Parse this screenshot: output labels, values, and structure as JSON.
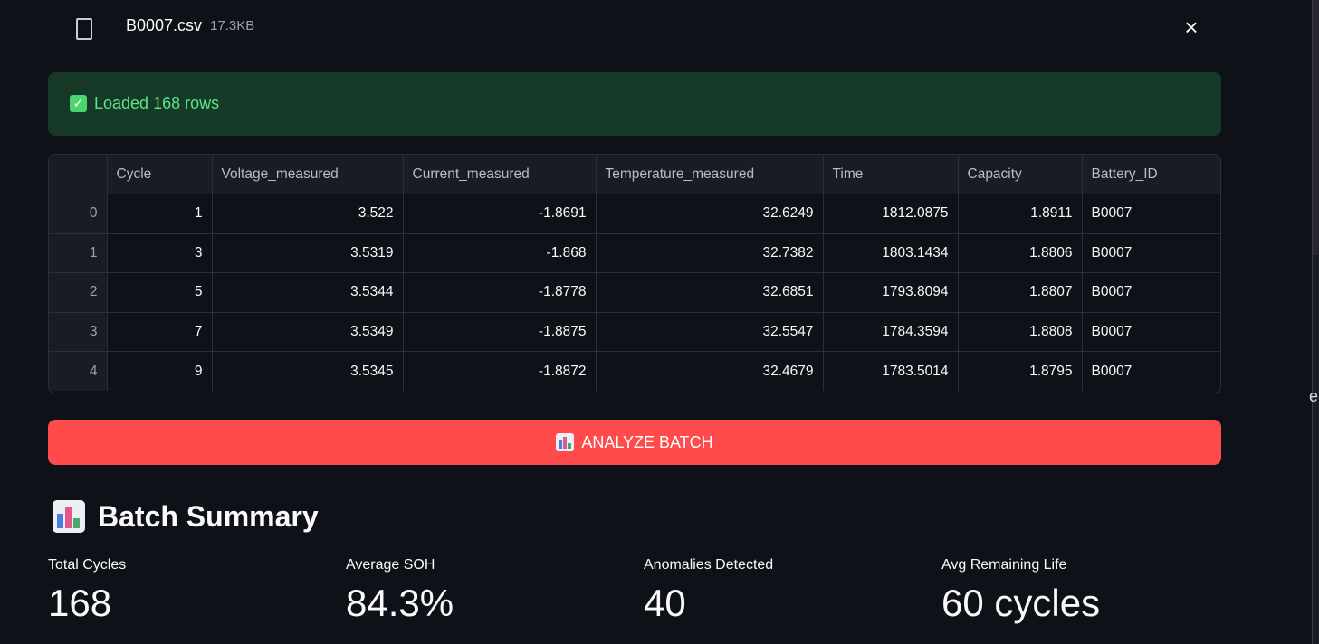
{
  "file": {
    "name": "B0007.csv",
    "size": "17.3KB",
    "close_symbol": "×"
  },
  "success": {
    "check": "✓",
    "message": "Loaded 168 rows"
  },
  "table": {
    "columns": [
      "",
      "Cycle",
      "Voltage_measured",
      "Current_measured",
      "Temperature_measured",
      "Time",
      "Capacity",
      "Battery_ID"
    ],
    "rows": [
      [
        "0",
        "1",
        "3.522",
        "-1.8691",
        "32.6249",
        "1812.0875",
        "1.8911",
        "B0007"
      ],
      [
        "1",
        "3",
        "3.5319",
        "-1.868",
        "32.7382",
        "1803.1434",
        "1.8806",
        "B0007"
      ],
      [
        "2",
        "5",
        "3.5344",
        "-1.8778",
        "32.6851",
        "1793.8094",
        "1.8807",
        "B0007"
      ],
      [
        "3",
        "7",
        "3.5349",
        "-1.8875",
        "32.5547",
        "1784.3594",
        "1.8808",
        "B0007"
      ],
      [
        "4",
        "9",
        "3.5345",
        "-1.8872",
        "32.4679",
        "1783.5014",
        "1.8795",
        "B0007"
      ]
    ]
  },
  "analyze_button": {
    "label": "ANALYZE BATCH",
    "icon": "bar-chart-icon"
  },
  "summary": {
    "title": "Batch Summary",
    "icon": "bar-chart-icon",
    "metrics": [
      {
        "label": "Total Cycles",
        "value": "168"
      },
      {
        "label": "Average SOH",
        "value": "84.3%"
      },
      {
        "label": "Anomalies Detected",
        "value": "40"
      },
      {
        "label": "Avg Remaining Life",
        "value": "60 cycles"
      }
    ]
  },
  "colors": {
    "background": "#0e1117",
    "success_bg": "#173928",
    "success_text": "#5ce488",
    "primary_button": "#ff4b4b",
    "table_header_bg": "#1a1c24"
  }
}
